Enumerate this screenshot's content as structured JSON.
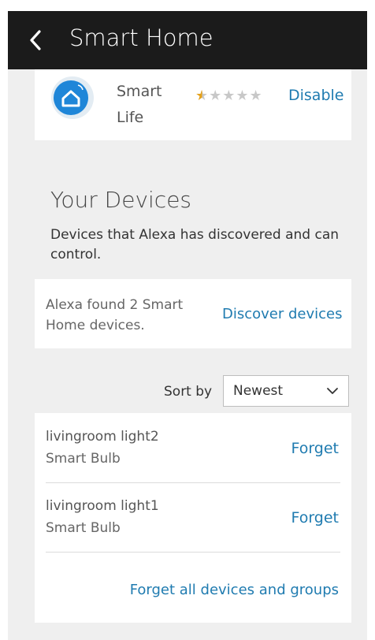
{
  "header": {
    "title": "Smart Home",
    "back_icon": "chevron-left-icon"
  },
  "skill": {
    "name": "Smart Life",
    "icon": "smart-life-home-icon",
    "rating_stars": "★★★★★",
    "rating_value": 0.5,
    "rating_max": 5,
    "action_label": "Disable"
  },
  "devices_section": {
    "title": "Your Devices",
    "description": "Devices that Alexa has discovered and can control."
  },
  "discover": {
    "status_text": "Alexa found 2 Smart Home devices.",
    "action_label": "Discover devices"
  },
  "sort": {
    "label": "Sort by",
    "selected": "Newest"
  },
  "devices": [
    {
      "name": "livingroom light2",
      "type": "Smart Bulb",
      "action_label": "Forget"
    },
    {
      "name": "livingroom light1",
      "type": "Smart Bulb",
      "action_label": "Forget"
    }
  ],
  "forget_all_label": "Forget all devices and groups",
  "colors": {
    "header_bg": "#1b1b1b",
    "page_bg": "#efefef",
    "link": "#1f7bb0",
    "star_filled": "#e4a11b",
    "star_empty": "#c8c8c8",
    "icon_blue": "#1f86d8"
  }
}
